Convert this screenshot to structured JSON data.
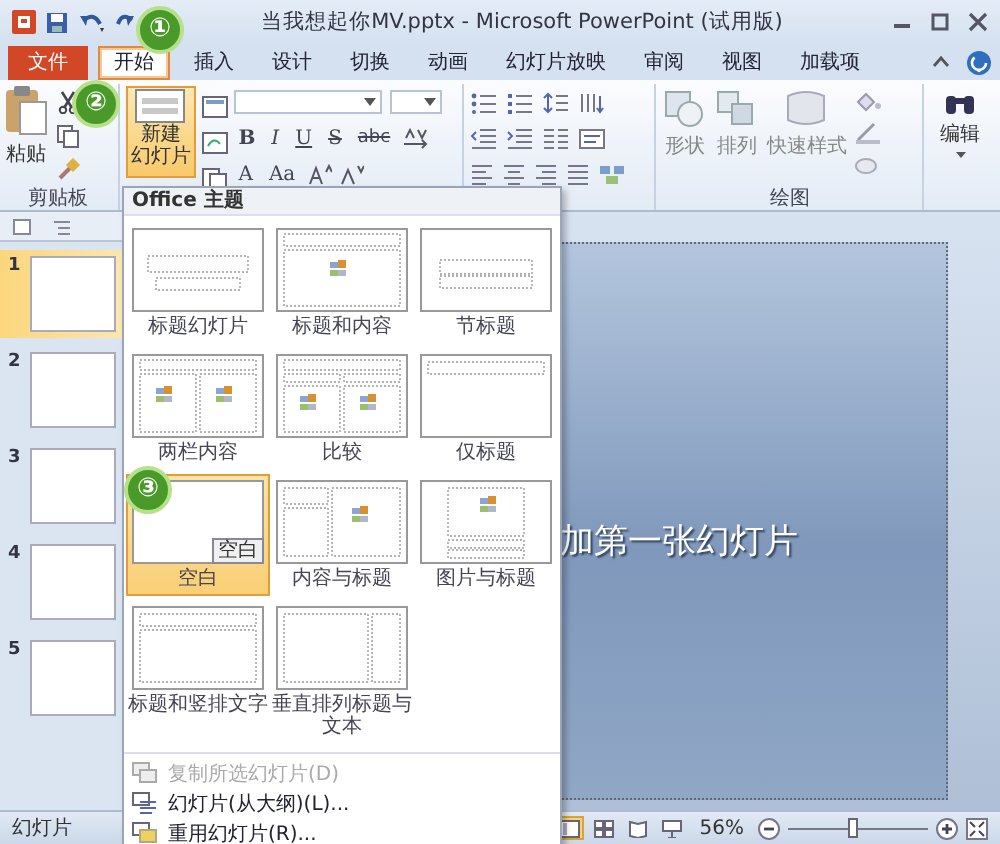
{
  "title_bar": {
    "title": "当我想起你MV.pptx - Microsoft PowerPoint (试用版)"
  },
  "ribbon_tabs": [
    {
      "label": "文件",
      "kind": "file",
      "selected": false
    },
    {
      "label": "开始",
      "kind": "tab",
      "selected": true
    },
    {
      "label": "插入",
      "kind": "tab",
      "selected": false
    },
    {
      "label": "设计",
      "kind": "tab",
      "selected": false
    },
    {
      "label": "切换",
      "kind": "tab",
      "selected": false
    },
    {
      "label": "动画",
      "kind": "tab",
      "selected": false
    },
    {
      "label": "幻灯片放映",
      "kind": "tab",
      "selected": false
    },
    {
      "label": "审阅",
      "kind": "tab",
      "selected": false
    },
    {
      "label": "视图",
      "kind": "tab",
      "selected": false
    },
    {
      "label": "加载项",
      "kind": "tab",
      "selected": false
    }
  ],
  "ribbon": {
    "clipboard": {
      "paste_label": "粘贴",
      "group_label": "剪贴板"
    },
    "new_slide": {
      "label_line_1": "新建",
      "label_line_2": "幻灯片",
      "pressed": true
    },
    "font": {
      "format_buttons": [
        "B",
        "I",
        "U",
        "S",
        "abc"
      ],
      "size_buttons": [
        "A",
        "Aa"
      ]
    },
    "drawing": {
      "buttons": [
        "形状",
        "排列",
        "快速样式"
      ],
      "group_label": "绘图"
    },
    "editing": {
      "label": "编辑"
    }
  },
  "slides_panel": {
    "slides": [
      {
        "number": "1",
        "selected": true
      },
      {
        "number": "2",
        "selected": false
      },
      {
        "number": "3",
        "selected": false
      },
      {
        "number": "4",
        "selected": false
      },
      {
        "number": "5",
        "selected": false
      }
    ]
  },
  "slide": {
    "text": "加第一张幻灯片"
  },
  "layout_menu": {
    "header": "Office 主题",
    "layouts": [
      {
        "label": "标题幻灯片",
        "kind": "title",
        "selected": false
      },
      {
        "label": "标题和内容",
        "kind": "title-content",
        "selected": false
      },
      {
        "label": "节标题",
        "kind": "section",
        "selected": false
      },
      {
        "label": "两栏内容",
        "kind": "two-content",
        "selected": false
      },
      {
        "label": "比较",
        "kind": "comparison",
        "selected": false
      },
      {
        "label": "仅标题",
        "kind": "title-only",
        "selected": false
      },
      {
        "label": "空白",
        "kind": "blank",
        "selected": true,
        "tooltip": "空白"
      },
      {
        "label": "内容与标题",
        "kind": "content-caption",
        "selected": false
      },
      {
        "label": "图片与标题",
        "kind": "picture-caption",
        "selected": false
      },
      {
        "label": "标题和竖排文字",
        "kind": "vertical-text",
        "selected": false
      },
      {
        "label": "垂直排列标题与文本",
        "kind": "vertical-title",
        "selected": false
      }
    ],
    "commands": [
      {
        "label": "复制所选幻灯片(D)",
        "kind": "duplicate",
        "disabled": true
      },
      {
        "label": "幻灯片(从大纲)(L)...",
        "kind": "outline",
        "disabled": false
      },
      {
        "label": "重用幻灯片(R)...",
        "kind": "reuse",
        "disabled": false
      }
    ]
  },
  "status_bar": {
    "slide_label": "幻灯片",
    "views": [
      {
        "kind": "normal",
        "selected": true
      },
      {
        "kind": "sorter",
        "selected": false
      },
      {
        "kind": "reading",
        "selected": false
      },
      {
        "kind": "show",
        "selected": false
      }
    ],
    "zoom": "56%",
    "zoom_slider": {
      "level": 0.45
    }
  },
  "step_badges": [
    {
      "label": "①"
    },
    {
      "label": "②"
    },
    {
      "label": "③"
    }
  ]
}
